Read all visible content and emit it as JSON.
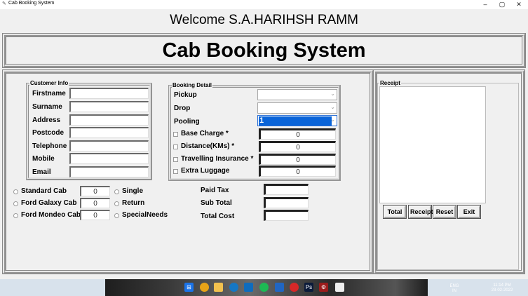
{
  "window": {
    "title": "Cab Booking System",
    "minimize": "–",
    "maximize": "▢",
    "close": "✕"
  },
  "welcome": "Welcome S.A.HARIHSH RAMM",
  "banner": "Cab Booking System",
  "customer": {
    "group_label": "Customer Info",
    "fields": [
      {
        "label": "Firstname",
        "value": ""
      },
      {
        "label": "Surname",
        "value": ""
      },
      {
        "label": "Address",
        "value": ""
      },
      {
        "label": "Postcode",
        "value": ""
      },
      {
        "label": "Telephone",
        "value": ""
      },
      {
        "label": "Mobile",
        "value": ""
      },
      {
        "label": "Email",
        "value": ""
      }
    ]
  },
  "booking": {
    "group_label": "Booking Detail",
    "pickup_label": "Pickup",
    "pickup_value": "",
    "drop_label": "Drop",
    "drop_value": "",
    "pooling_label": "Pooling",
    "pooling_value": "1",
    "checks": [
      {
        "label": "Base Charge *",
        "value": "0"
      },
      {
        "label": "Distance(KMs) *",
        "value": "0"
      },
      {
        "label": "Travelling Insurance *",
        "value": "0"
      },
      {
        "label": "Extra Luggage",
        "value": "0"
      }
    ]
  },
  "cabs": [
    {
      "label": "Standard Cab",
      "value": "0"
    },
    {
      "label": "Ford Galaxy Cab",
      "value": "0"
    },
    {
      "label": "Ford Mondeo Cab",
      "value": "0"
    }
  ],
  "trip": [
    "Single",
    "Return",
    "SpecialNeeds"
  ],
  "totals": [
    {
      "label": "Paid Tax",
      "value": ""
    },
    {
      "label": "Sub Total",
      "value": ""
    },
    {
      "label": "Total Cost",
      "value": ""
    }
  ],
  "receipt": {
    "group_label": "Receipt",
    "buttons": [
      "Total",
      "Receipt",
      "Reset",
      "Exit"
    ]
  },
  "taskbar": {
    "lang": "ENG",
    "region": "IN",
    "time": "11:14 PM",
    "date": "23-02-2022"
  }
}
